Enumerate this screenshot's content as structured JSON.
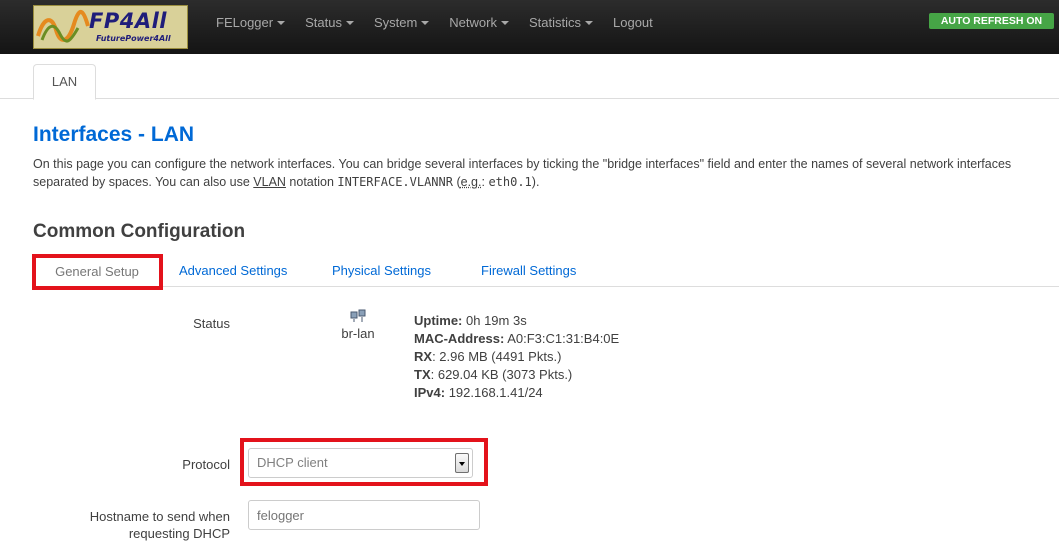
{
  "logo": {
    "name": "FP4All",
    "tagline": "FuturePower4All"
  },
  "nav": {
    "items": [
      {
        "label": "FELogger",
        "dropdown": true
      },
      {
        "label": "Status",
        "dropdown": true
      },
      {
        "label": "System",
        "dropdown": true
      },
      {
        "label": "Network",
        "dropdown": true
      },
      {
        "label": "Statistics",
        "dropdown": true
      },
      {
        "label": "Logout",
        "dropdown": false
      }
    ],
    "auto_refresh": "AUTO REFRESH ON"
  },
  "main_tabs": {
    "active": "LAN"
  },
  "page": {
    "title": "Interfaces - LAN",
    "desc_1": "On this page you can configure the network interfaces. You can bridge several interfaces by ticking the \"bridge interfaces\" field and enter the names of several network interfaces separated by spaces. You can also use ",
    "desc_vlan": "VLAN",
    "desc_2": " notation ",
    "desc_code": "INTERFACE.VLANNR",
    "desc_3": " (",
    "desc_eg": "e.g.",
    "desc_4": ": ",
    "desc_example": "eth0.1",
    "desc_5": ")."
  },
  "section": {
    "title": "Common Configuration",
    "tabs": [
      "General Setup",
      "Advanced Settings",
      "Physical Settings",
      "Firewall Settings"
    ],
    "active_tab": "General Setup"
  },
  "status": {
    "label": "Status",
    "interface": "br-lan",
    "uptime_label": "Uptime:",
    "uptime": " 0h 19m 3s",
    "mac_label": "MAC-Address:",
    "mac": " A0:F3:C1:31:B4:0E",
    "rx_label": "RX",
    "rx": ": 2.96 MB (4491 Pkts.)",
    "tx_label": "TX",
    "tx": ": 629.04 KB (3073 Pkts.)",
    "ipv4_label": "IPv4:",
    "ipv4": " 192.168.1.41/24"
  },
  "protocol": {
    "label": "Protocol",
    "value": "DHCP client"
  },
  "hostname": {
    "label_1": "Hostname to send when",
    "label_2": "requesting DHCP",
    "placeholder": "felogger"
  },
  "colors": {
    "accent": "#0069d6",
    "highlight": "#e3121b",
    "badge": "#46a546"
  }
}
